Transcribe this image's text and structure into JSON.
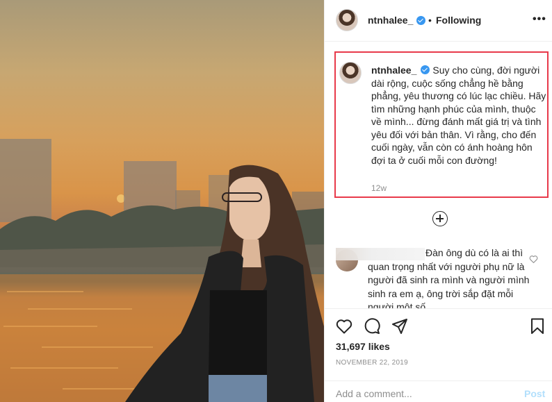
{
  "header": {
    "username": "ntnhalee_",
    "separator": "•",
    "follow_label": "Following",
    "more_label": "•••"
  },
  "caption": {
    "username": "ntnhalee_",
    "text": "Suy cho cùng, đời người dài rộng, cuộc sống chẳng hề bằng phẳng, yêu thương có lúc lạc chiều. Hãy tìm những hạnh phúc của mình, thuộc về mình... đừng đánh mất giá trị và tình yêu đối với bản thân. Vì rằng, cho đến cuối ngày, vẫn còn có ánh hoàng hôn đợi ta ở cuối mỗi con đường!",
    "time": "12w"
  },
  "comment": {
    "text": "Đàn ông dù có là ai thì quan trọng nhất với người phụ nữ là người đã sinh ra mình và người mình sinh ra em ạ, ông trời sắp đặt mỗi người một số"
  },
  "likes": "31,697 likes",
  "date": "NOVEMBER 22, 2019",
  "add_comment": {
    "placeholder": "Add a comment...",
    "post_label": "Post"
  },
  "colors": {
    "highlight_border": "#e8394a",
    "verified": "#3897f0",
    "post_disabled": "#b2dffc"
  },
  "icons": [
    "verified-badge-icon",
    "more-options-icon",
    "load-more-icon",
    "heart-icon",
    "comment-icon",
    "share-icon",
    "bookmark-icon"
  ]
}
